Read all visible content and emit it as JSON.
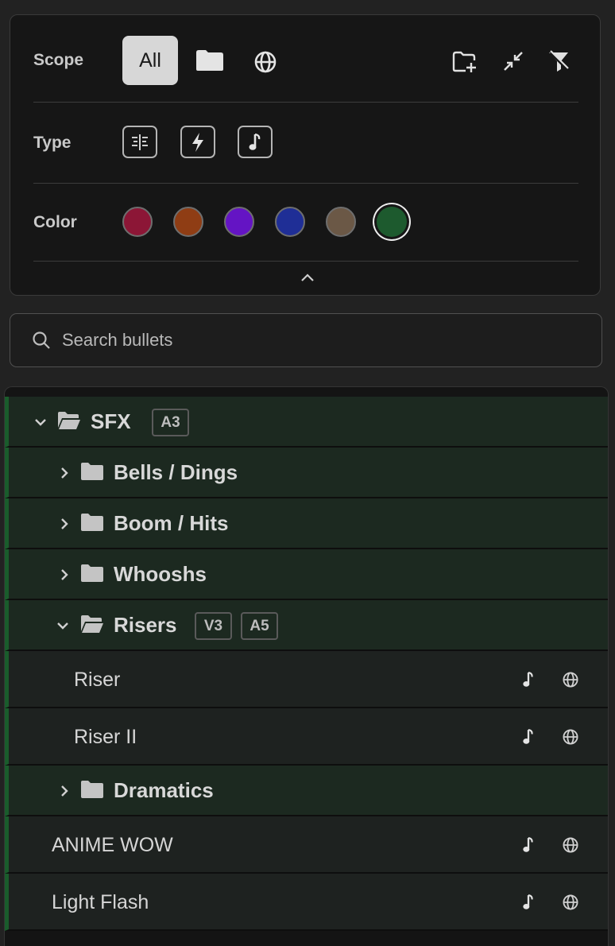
{
  "filters": {
    "scope_label": "Scope",
    "scope_all": "All",
    "scope_icons": [
      "folder-icon",
      "globe-icon"
    ],
    "toolbar_icons": [
      "new-folder-icon",
      "collapse-all-icon",
      "clear-filter-icon"
    ],
    "type_label": "Type",
    "type_icons": [
      "sequence-icon",
      "lightning-icon",
      "music-note-icon"
    ],
    "color_label": "Color",
    "colors": [
      "#8c1636",
      "#8f3d14",
      "#6414c4",
      "#1f2e96",
      "#6b5846",
      "#1d5a2e"
    ],
    "selected_color": "#1d5a2e"
  },
  "search": {
    "placeholder": "Search bullets"
  },
  "tree": {
    "accent": "#1a5c2c",
    "rows": [
      {
        "label": "SFX",
        "badges": [
          "A3"
        ]
      },
      {
        "label": "Bells / Dings"
      },
      {
        "label": "Boom / Hits"
      },
      {
        "label": "Whooshs"
      },
      {
        "label": "Risers",
        "badges": [
          "V3",
          "A5"
        ]
      },
      {
        "label": "Riser"
      },
      {
        "label": "Riser II"
      },
      {
        "label": "Dramatics"
      },
      {
        "label": "ANIME WOW"
      },
      {
        "label": "Light Flash"
      }
    ]
  }
}
